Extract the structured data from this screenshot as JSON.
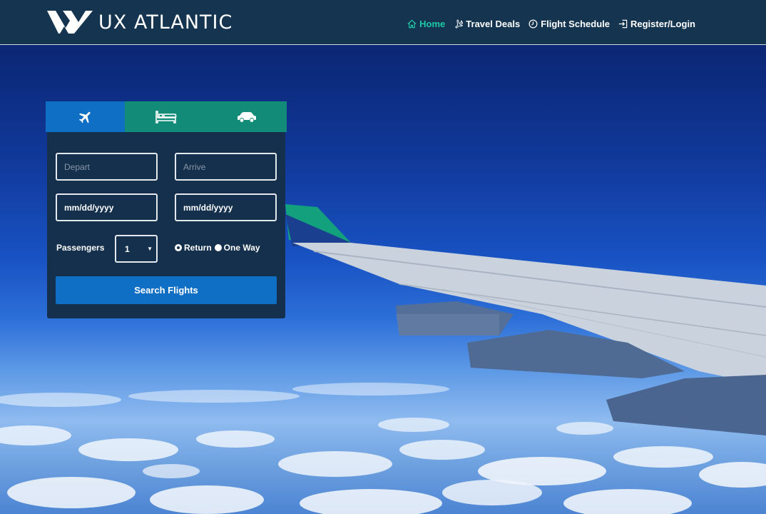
{
  "brand": {
    "name": "UX ATLANTIC"
  },
  "nav": [
    {
      "label": "Home",
      "icon": "home-icon",
      "active": true
    },
    {
      "label": "Travel Deals",
      "icon": "plane-icon",
      "active": false
    },
    {
      "label": "Flight Schedule",
      "icon": "clock-icon",
      "active": false
    },
    {
      "label": "Register/Login",
      "icon": "login-icon",
      "active": false
    }
  ],
  "booking": {
    "tabs": [
      {
        "name": "flights",
        "icon": "airplane-icon"
      },
      {
        "name": "hotels",
        "icon": "bed-icon"
      },
      {
        "name": "cars",
        "icon": "car-icon"
      }
    ],
    "depart_placeholder": "Depart",
    "arrive_placeholder": "Arrive",
    "depart_date": "mm/dd/yyyy",
    "return_date": "mm/dd/yyyy",
    "passengers_label": "Passengers",
    "passengers_value": "1",
    "trip_options": [
      {
        "label": "Return",
        "checked": true
      },
      {
        "label": "One Way",
        "checked": false
      }
    ],
    "search_label": "Search Flights"
  },
  "colors": {
    "header_bg": "#14344f",
    "accent_teal": "#1fc9a7",
    "tab_blue": "#0f6fc4",
    "tab_green": "#128c78",
    "panel_bg": "#15304c"
  }
}
